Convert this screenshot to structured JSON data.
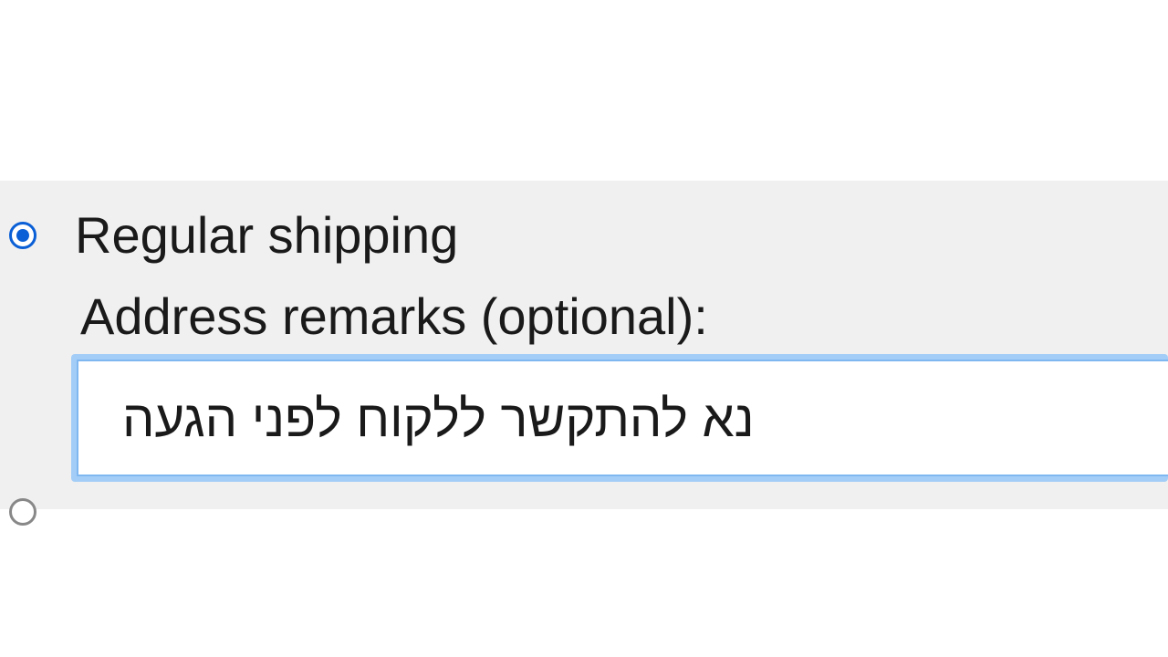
{
  "shipping": {
    "option_label": "Regular shipping",
    "option_selected": true,
    "remarks_label": "Address remarks (optional):",
    "remarks_value": "נא להתקשר ללקוח לפני הגעה"
  }
}
